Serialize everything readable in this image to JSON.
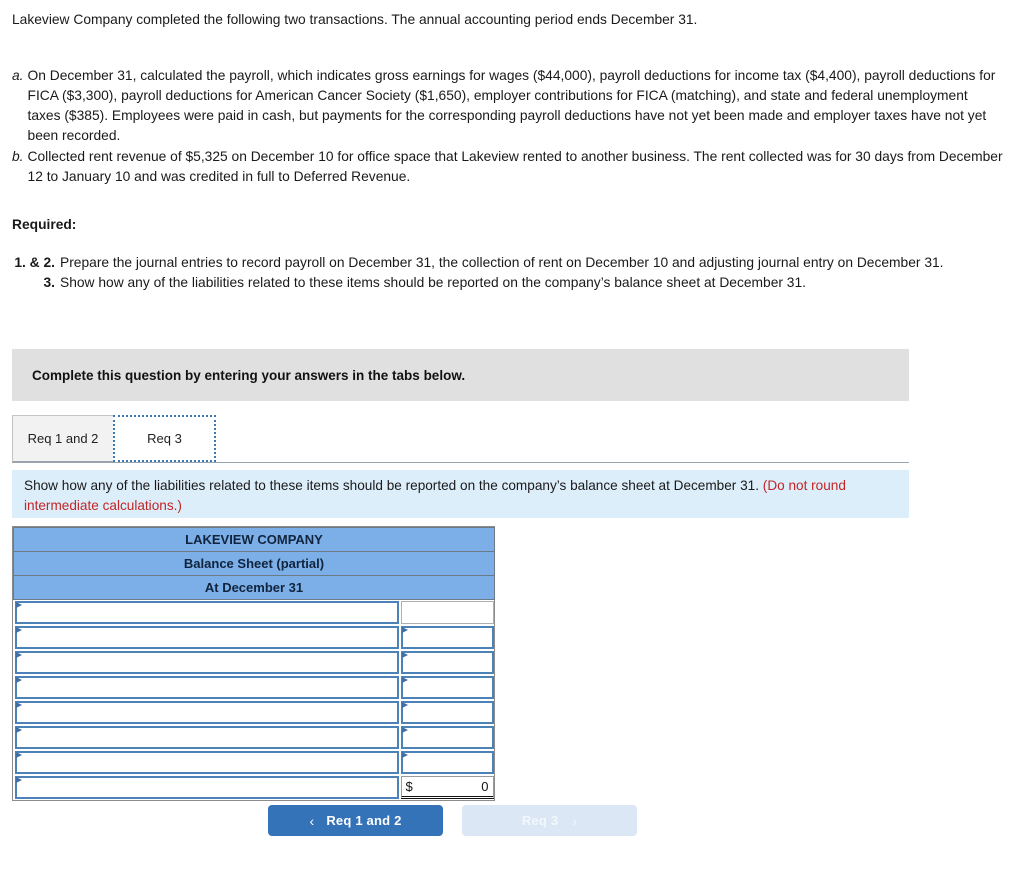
{
  "intro": {
    "text": "Lakeview Company completed the following two transactions. The annual accounting period ends December 31."
  },
  "transactions": [
    {
      "marker": "a.",
      "text": "On December 31, calculated the payroll, which indicates gross earnings for wages ($44,000), payroll deductions for income tax ($4,400), payroll deductions for FICA ($3,300), payroll deductions for American Cancer Society ($1,650), employer contributions for FICA (matching), and state and federal unemployment taxes ($385). Employees were paid in cash, but payments for the corresponding payroll deductions have not yet been made and employer taxes have not yet been recorded."
    },
    {
      "marker": "b.",
      "text": "Collected rent revenue of $5,325 on December 10 for office space that Lakeview rented to another business. The rent collected was for 30 days from December 12 to January 10 and was credited in full to Deferred Revenue."
    }
  ],
  "required": {
    "heading": "Required:",
    "items": [
      {
        "number": "1. & 2.",
        "text": "Prepare the journal entries to record payroll on December 31, the collection of rent on December 10 and adjusting journal entry on December 31."
      },
      {
        "number": "3.",
        "text": "Show how any of the liabilities related to these items should be reported on the company’s balance sheet at December 31."
      }
    ]
  },
  "grey_banner": {
    "text": "Complete this question by entering your answers in the tabs below."
  },
  "tabs": [
    {
      "label": "Req 1 and 2",
      "active": false
    },
    {
      "label": "Req 3",
      "active": true
    }
  ],
  "question_banner": {
    "text": "Show how any of the liabilities related to these items should be reported on the company’s balance sheet at December 31.",
    "note": "(Do not round intermediate calculations.)"
  },
  "balance_sheet": {
    "header_rows": [
      "LAKEVIEW COMPANY",
      "Balance Sheet (partial)",
      "At December 31"
    ],
    "rows": [
      {
        "label": "",
        "amount": "",
        "label_input": true,
        "amount_input": false,
        "total": false
      },
      {
        "label": "",
        "amount": "",
        "label_input": true,
        "amount_input": true,
        "total": false
      },
      {
        "label": "",
        "amount": "",
        "label_input": true,
        "amount_input": true,
        "total": false
      },
      {
        "label": "",
        "amount": "",
        "label_input": true,
        "amount_input": true,
        "total": false
      },
      {
        "label": "",
        "amount": "",
        "label_input": true,
        "amount_input": true,
        "total": false
      },
      {
        "label": "",
        "amount": "",
        "label_input": true,
        "amount_input": true,
        "total": false
      },
      {
        "label": "",
        "amount": "",
        "label_input": true,
        "amount_input": true,
        "total": false
      },
      {
        "label": "",
        "amount": "0",
        "label_input": true,
        "amount_input": false,
        "total": true
      }
    ],
    "currency_symbol": "$",
    "total_value": "0"
  },
  "nav": {
    "prev_label": "Req 1 and 2",
    "prev_chevron": "‹",
    "next_label": "Req 3",
    "next_chevron": "›"
  },
  "colors": {
    "header_blue": "#7cafe8",
    "banner_grey": "#e0e0e0",
    "banner_blue": "#ddeefb",
    "note_red": "#c22626",
    "button_blue": "#3573b9",
    "button_disabled": "#dbe7f4",
    "field_border": "#4d82b8"
  }
}
